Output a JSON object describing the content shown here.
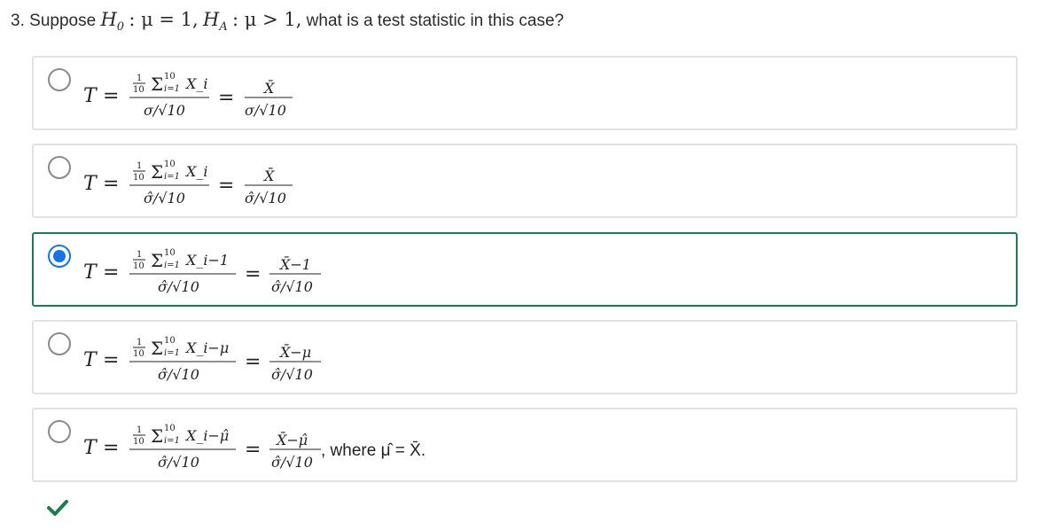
{
  "question": {
    "number": "3.",
    "prefix": "Suppose",
    "h0": "H",
    "h0_sub": "0",
    "h0_rest": ": μ = 1,",
    "ha": "H",
    "ha_sub": "A",
    "ha_rest": ": μ > 1,",
    "suffix": "what is a test statistic in this case?"
  },
  "options": [
    {
      "lhs": "T =",
      "num1": "X_i",
      "den1": "σ/√10",
      "num2": "X̄",
      "den2": "σ/√10",
      "selected": false,
      "tail": ""
    },
    {
      "lhs": "T =",
      "num1": "X_i",
      "den1": "σ̂/√10",
      "num2": "X̄",
      "den2": "σ̂/√10",
      "selected": false,
      "tail": ""
    },
    {
      "lhs": "T =",
      "num1": "X_i−1",
      "den1": "σ̂/√10",
      "num2": "X̄−1",
      "den2": "σ̂/√10",
      "selected": true,
      "tail": ""
    },
    {
      "lhs": "T =",
      "num1": "X_i−μ",
      "den1": "σ̂/√10",
      "num2": "X̄−μ",
      "den2": "σ̂/√10",
      "selected": false,
      "tail": ""
    },
    {
      "lhs": "T =",
      "num1": "X_i−μ̂",
      "den1": "σ̂/√10",
      "num2": "X̄−μ̂",
      "den2": "σ̂/√10",
      "selected": false,
      "tail": ", where μ̂ = X̄."
    }
  ],
  "result": {
    "icon": "checkmark-icon",
    "color": "#1f7a4d"
  },
  "colors": {
    "selected_border": "#1f7a4d",
    "radio_checked": "#1673e6"
  }
}
